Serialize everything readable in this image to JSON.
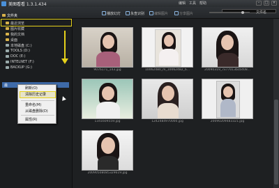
{
  "window": {
    "title": "美图看看 1.3.1.434",
    "menus": [
      "编辑",
      "工具",
      "帮助"
    ]
  },
  "toolbar": {
    "slideshow": "播放幻灯",
    "fullscreen": "永查识别",
    "edit": "编辑图片",
    "share": "分享图片",
    "sort_label": "文件名"
  },
  "sidebar": {
    "items": [
      {
        "label": "文件夹",
        "icon": "folder-icon"
      },
      {
        "label": "最近浏览",
        "icon": "folder-icon"
      },
      {
        "label": "图片收藏",
        "icon": "folder-icon"
      },
      {
        "label": "我的文档",
        "icon": "folder-icon"
      },
      {
        "label": "桌面",
        "icon": "folder-icon"
      },
      {
        "label": "本地磁盘 (C:)",
        "icon": "drive-icon"
      },
      {
        "label": "TOOLS (D:)",
        "icon": "drive-icon"
      },
      {
        "label": "DOC (E:)",
        "icon": "drive-icon"
      },
      {
        "label": "INTELNET (F:)",
        "icon": "drive-icon"
      },
      {
        "label": "BACKUP (G:)",
        "icon": "drive-icon"
      }
    ],
    "selected_row_label": "最"
  },
  "context_menu": {
    "items": [
      "刷新(O)",
      "清除历史记录",
      "重命名(M)",
      "从磁盘删除(D)",
      "属性(R)"
    ]
  },
  "thumbnails": [
    {
      "caption": "9076171_143.jpg"
    },
    {
      "caption": "10062480_m_10062482_6..."
    },
    {
      "caption": "20090319_7x77013bcb408..."
    },
    {
      "caption": "1341609559.jpg"
    },
    {
      "caption": "1242484970000.jpg"
    },
    {
      "caption": "20090209483321.jpg"
    },
    {
      "caption": "20090508085329619.jpg"
    }
  ],
  "colors": {
    "highlight": "#e6d21a",
    "selection": "#3e6aa8"
  }
}
